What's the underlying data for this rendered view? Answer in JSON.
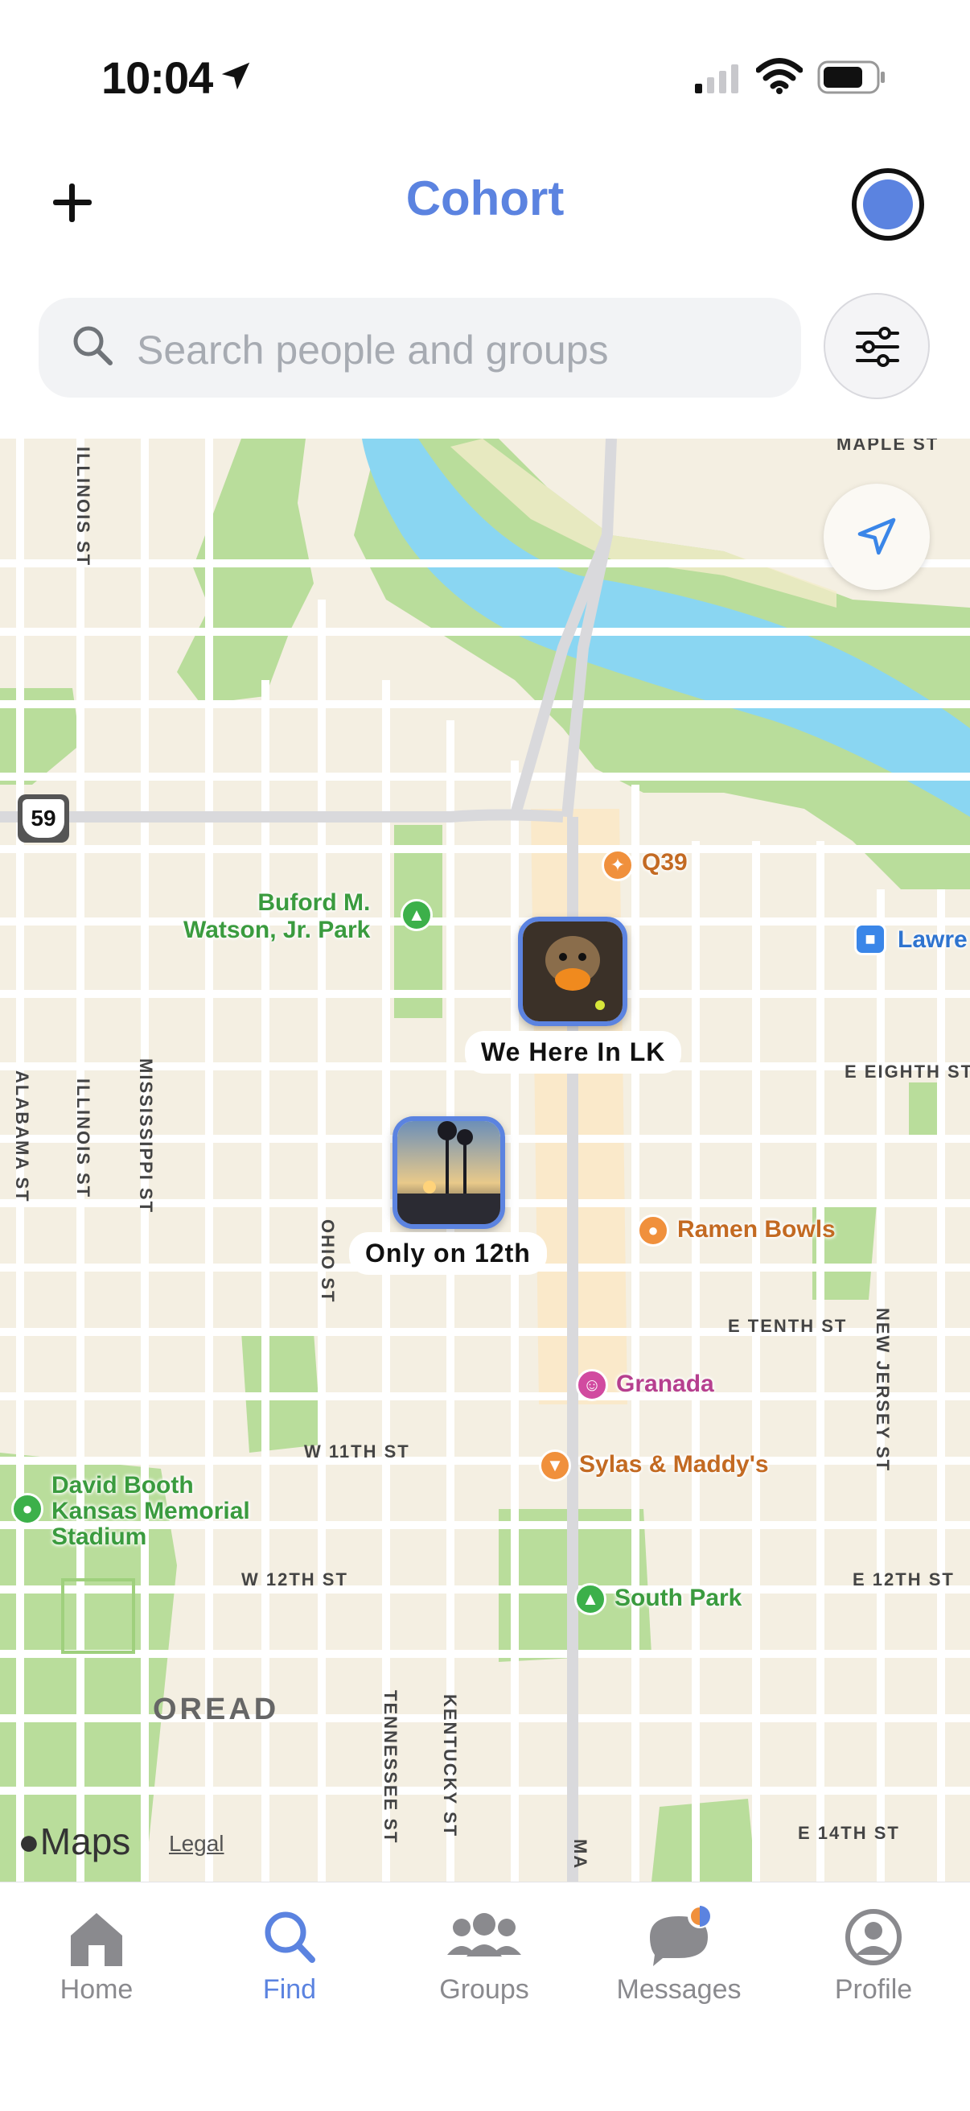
{
  "status_bar": {
    "time": "10:04"
  },
  "header": {
    "title": "Cohort"
  },
  "search": {
    "placeholder": "Search people and groups"
  },
  "map": {
    "streets": [
      "MAPLE ST",
      "ILLINOIS ST",
      "ALABAMA ST",
      "ILLINOIS ST",
      "MISSISSIPPI ST",
      "OHIO ST",
      "E EIGHTH ST",
      "E TENTH ST",
      "NEW JERSEY ST",
      "W 11TH ST",
      "W 12TH ST",
      "E 12TH ST",
      "TENNESSEE ST",
      "KENTUCKY ST",
      "MA",
      "E 14TH ST",
      "OREAD"
    ],
    "highway_shield": "59",
    "pois": {
      "q39": "Q39",
      "buford_park": "Buford M.\nWatson, Jr. Park",
      "lawrence_station": "Lawre",
      "ramen_bowls": "Ramen Bowls",
      "granada": "Granada",
      "sylas_maddys": "Sylas & Maddy's",
      "david_booth": "David Booth\nKansas Memorial\nStadium",
      "south_park": "South Park"
    },
    "groups": [
      {
        "label": "We Here In LK"
      },
      {
        "label": "Only on 12th"
      }
    ],
    "attribution": {
      "maps": "Maps",
      "legal": "Legal"
    }
  },
  "tabbar": {
    "items": [
      {
        "label": "Home",
        "active": false
      },
      {
        "label": "Find",
        "active": true
      },
      {
        "label": "Groups",
        "active": false
      },
      {
        "label": "Messages",
        "active": false
      },
      {
        "label": "Profile",
        "active": false
      }
    ]
  },
  "colors": {
    "accent": "#5b83e0",
    "water": "#8ad6f2",
    "park": "#b9dd9b",
    "land": "#f4efe2"
  }
}
